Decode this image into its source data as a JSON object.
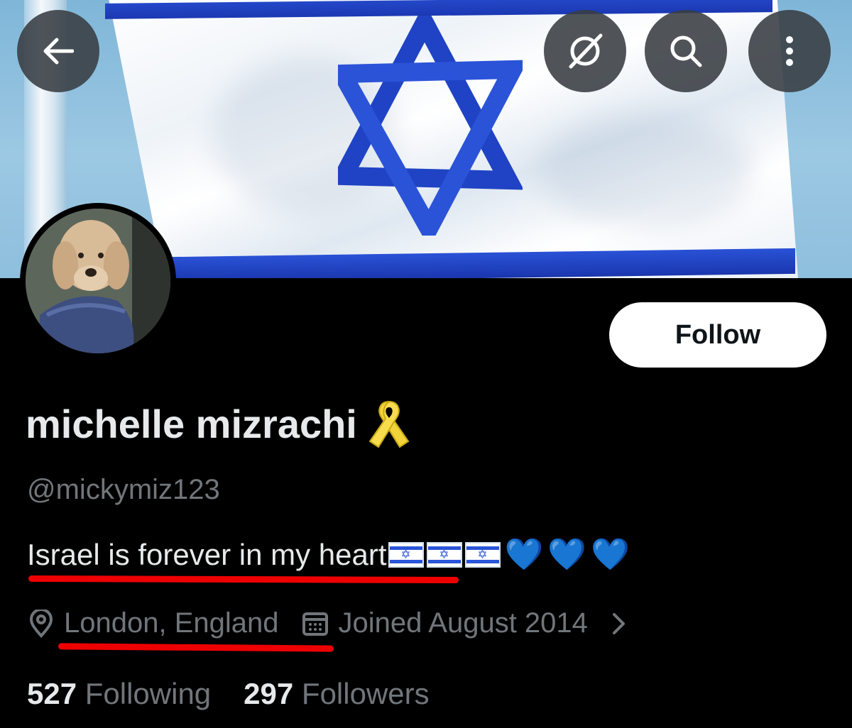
{
  "header": {
    "back_label": "Back",
    "grok_label": "Grok",
    "search_label": "Search",
    "more_label": "More"
  },
  "profile": {
    "display_name": "michelle mizrachi",
    "name_badge_icon": "yellow-ribbon-icon",
    "handle": "@mickymiz123",
    "bio_text": "Israel is forever in my heart",
    "bio_flags": [
      "✡",
      "✡",
      "✡"
    ],
    "bio_hearts": [
      "💙",
      "💙",
      "💙"
    ],
    "location": "London, England",
    "joined": "Joined August 2014",
    "following_count": "527",
    "following_label": "Following",
    "followers_count": "297",
    "followers_label": "Followers"
  },
  "actions": {
    "follow_label": "Follow"
  },
  "colors": {
    "background": "#000000",
    "primary_text": "#e7e9ea",
    "secondary_text": "#71767b",
    "annotation_underline": "#ee0000",
    "flag_blue": "#2448c9",
    "heart_blue": "#2a9df4",
    "ribbon_yellow": "#f2d43a"
  }
}
